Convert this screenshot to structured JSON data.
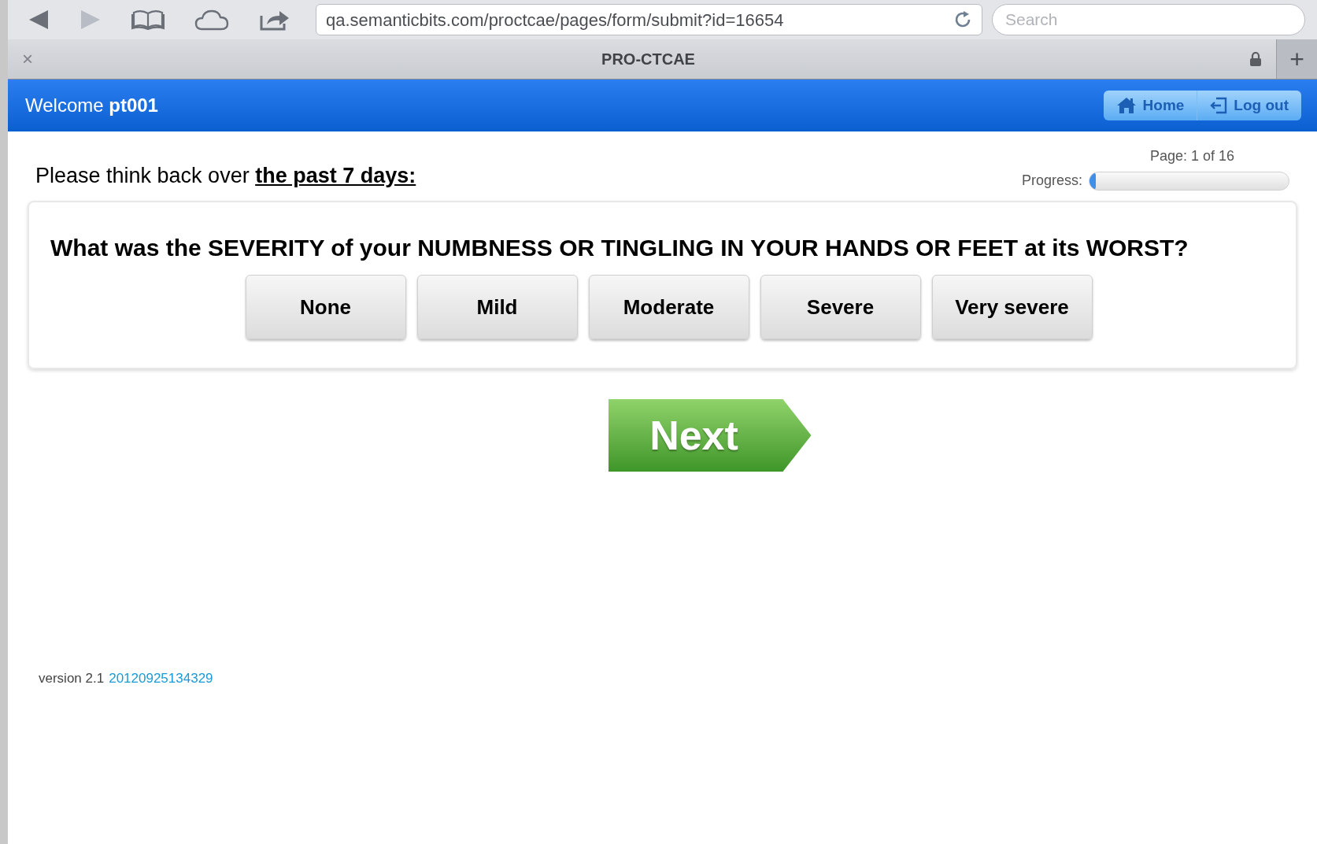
{
  "browser": {
    "url": "qa.semanticbits.com/proctcae/pages/form/submit?id=16654",
    "search": {
      "placeholder": "Search"
    },
    "tab": {
      "title": "PRO-CTCAE",
      "close": "×",
      "new_tab": "+"
    }
  },
  "header": {
    "welcome": "Welcome **pt001**",
    "buttons": [
      {
        "kind": "home",
        "label": "Home"
      },
      {
        "kind": "logout",
        "label": "Log out"
      }
    ]
  },
  "page_indicator": "Page: 1 of 16",
  "progress": {
    "label": "Progress:",
    "level": 0.03
  },
  "prompt": "Please think back over **the past 7 days:**",
  "question": "What was the SEVERITY of your NUMBNESS OR TINGLING IN YOUR HANDS OR FEET at its WORST?",
  "answers": [
    {
      "label": "None",
      "selected": false
    },
    {
      "label": "Mild",
      "selected": false
    },
    {
      "label": "Moderate",
      "selected": false
    },
    {
      "label": "Severe",
      "selected": false
    },
    {
      "label": "Very severe",
      "selected": false
    }
  ],
  "next_button": "Next",
  "footer": {
    "version": "version 2.1",
    "build": "20120925134329"
  }
}
